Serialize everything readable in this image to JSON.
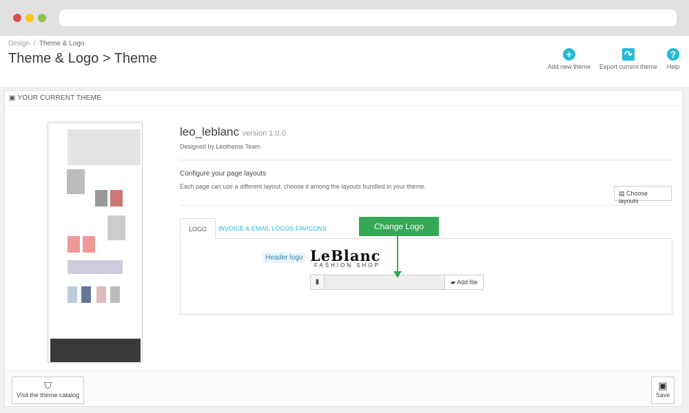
{
  "window": {
    "dots": [
      "#d9534f",
      "#f5c518",
      "#8cc152"
    ]
  },
  "breadcrumb": {
    "parent": "Design",
    "separator": "/",
    "current": "Theme & Logo"
  },
  "page_title": "Theme & Logo > Theme",
  "toolbar": [
    {
      "label": "Add new theme",
      "icon": "plus-circle-icon"
    },
    {
      "label": "Export current theme",
      "icon": "share-icon"
    },
    {
      "label": "Help",
      "icon": "question-circle-icon"
    }
  ],
  "panel": {
    "heading": "YOUR CURRENT THEME",
    "theme_name": "leo_leblanc",
    "version": "version 1.0.0",
    "designer": "Designed by Leotheme Team",
    "layouts_title": "Configure your page layouts",
    "layouts_desc": "Each page can use a different layout, choose it among the layouts bundled in your theme.",
    "choose_layouts": "Choose layouts",
    "tabs": [
      {
        "label": "LOGO",
        "active": true
      },
      {
        "label": "INVOICE & EMAIL LOGOS",
        "active": false
      },
      {
        "label": "FAVICONS",
        "active": false
      }
    ],
    "header_logo_label": "Header logo",
    "logo_text": "LeBlanc",
    "logo_sub": "FASHION SHOP",
    "add_file": "Add file",
    "catalog_button": "Visit the theme catalog",
    "save_button": "Save"
  },
  "annotation": {
    "label": "Change Logo",
    "color": "#34a853"
  },
  "colors": {
    "accent": "#25b9d7"
  }
}
